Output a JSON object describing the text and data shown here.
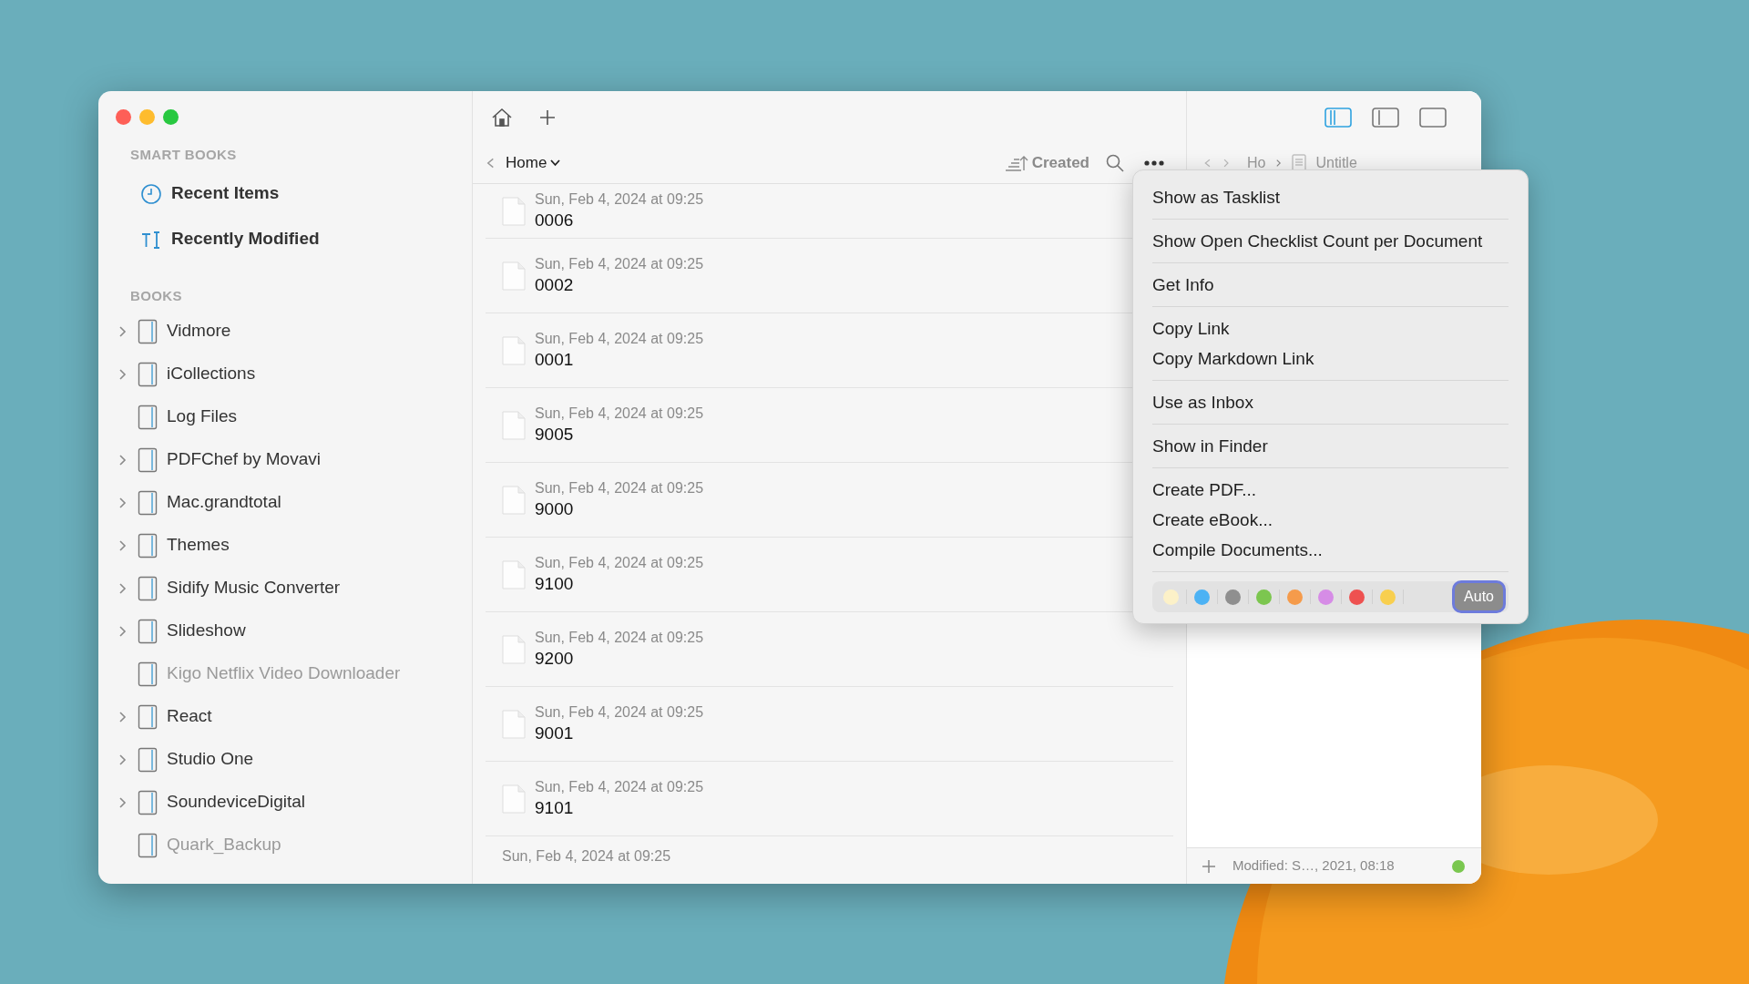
{
  "sidebar": {
    "sections": [
      {
        "title": "SMART BOOKS",
        "kind": "smart",
        "items": [
          {
            "label": "Recent Items",
            "dimmed": false
          },
          {
            "label": "Recently Modified",
            "dimmed": false
          }
        ]
      },
      {
        "title": "BOOKS",
        "kind": "books",
        "items": [
          {
            "label": "Vidmore",
            "expandable": true,
            "dimmed": false
          },
          {
            "label": "iCollections",
            "expandable": true,
            "dimmed": false
          },
          {
            "label": "Log Files",
            "expandable": false,
            "dimmed": false
          },
          {
            "label": "PDFChef by Movavi",
            "expandable": true,
            "dimmed": false
          },
          {
            "label": "Mac.grandtotal",
            "expandable": true,
            "dimmed": false
          },
          {
            "label": "Themes",
            "expandable": true,
            "dimmed": false
          },
          {
            "label": "Sidify Music Converter",
            "expandable": true,
            "dimmed": false
          },
          {
            "label": "Slideshow",
            "expandable": true,
            "dimmed": false
          },
          {
            "label": "Kigo Netflix Video Downloader",
            "expandable": false,
            "dimmed": true
          },
          {
            "label": "React",
            "expandable": true,
            "dimmed": false
          },
          {
            "label": "Studio One",
            "expandable": true,
            "dimmed": false
          },
          {
            "label": "SoundeviceDigital",
            "expandable": true,
            "dimmed": false
          },
          {
            "label": "Quark_Backup",
            "expandable": false,
            "dimmed": true
          }
        ]
      }
    ]
  },
  "list": {
    "location": "Home",
    "sort": "Created",
    "documents": [
      {
        "date": "Sun, Feb 4, 2024 at 09:25",
        "title": "0006"
      },
      {
        "date": "Sun, Feb 4, 2024 at 09:25",
        "title": "0002"
      },
      {
        "date": "Sun, Feb 4, 2024 at 09:25",
        "title": "0001"
      },
      {
        "date": "Sun, Feb 4, 2024 at 09:25",
        "title": "9005"
      },
      {
        "date": "Sun, Feb 4, 2024 at 09:25",
        "title": "9000"
      },
      {
        "date": "Sun, Feb 4, 2024 at 09:25",
        "title": "9100"
      },
      {
        "date": "Sun, Feb 4, 2024 at 09:25",
        "title": "9200"
      },
      {
        "date": "Sun, Feb 4, 2024 at 09:25",
        "title": "9001"
      },
      {
        "date": "Sun, Feb 4, 2024 at 09:25",
        "title": "9101"
      },
      {
        "date": "Sun, Feb 4, 2024 at 09:25"
      }
    ]
  },
  "editor": {
    "layouts": [
      {
        "kind": "three",
        "selected": true
      },
      {
        "kind": "two",
        "selected": false
      },
      {
        "kind": "one",
        "selected": false
      }
    ],
    "breadcrumb": [
      "Ho",
      "Untitle"
    ],
    "status": {
      "text": "Modified: S…, 2021, 08:18",
      "color": "#7ac74f"
    }
  },
  "menu": {
    "groups": [
      [
        "Show as Tasklist"
      ],
      [
        "Show Open Checklist Count per Document"
      ],
      [
        "Get Info"
      ],
      [
        "Copy Link",
        "Copy Markdown Link"
      ],
      [
        "Use as Inbox"
      ],
      [
        "Show in Finder"
      ],
      [
        "Create PDF...",
        "Create eBook...",
        "Compile Documents..."
      ]
    ],
    "swatches": [
      {
        "color": "#fcf1c8"
      },
      {
        "color": "#4cb2f4"
      },
      {
        "color": "#8f8f8f"
      },
      {
        "color": "#7cc64f"
      },
      {
        "color": "#f59b4b"
      },
      {
        "color": "#d68ce6"
      },
      {
        "color": "#ee5150"
      },
      {
        "color": "#f8cf4f"
      }
    ],
    "auto": {
      "label": "Auto",
      "selected": true
    }
  }
}
